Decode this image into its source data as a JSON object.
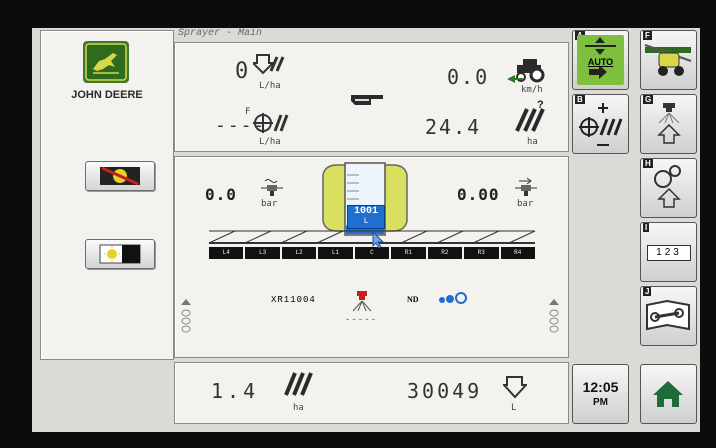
{
  "title": "Sprayer - Main",
  "brand": {
    "name": "JOHN DEERE"
  },
  "rate": {
    "actual_value": "0",
    "actual_unit": "L/ha",
    "target_value": "----",
    "target_super": "F",
    "target_unit": "L/ha"
  },
  "speed": {
    "value": "0.0",
    "unit": "km/h"
  },
  "area_remaining": {
    "value": "24.4",
    "unit": "ha",
    "badge": "?"
  },
  "pressure_left": {
    "value": "0.0",
    "unit": "bar"
  },
  "pressure_right": {
    "value": "0.00",
    "unit": "bar"
  },
  "tank": {
    "value": "1001",
    "unit": "L",
    "fill_fraction": 0.12
  },
  "boom_sections": [
    "L4",
    "L3",
    "L2",
    "L1",
    "C",
    "R1",
    "R2",
    "R3",
    "R4"
  ],
  "nozzle": {
    "name": "XR11004",
    "dashes": "-----",
    "nd_label": "ND"
  },
  "totals": {
    "area_value": "1.4",
    "area_unit": "ha",
    "volume_value": "30049",
    "volume_unit": "L"
  },
  "clock": {
    "time": "12:05",
    "ampm": "PM"
  },
  "softkeys": {
    "a": {
      "letter": "A",
      "label": "AUTO"
    },
    "b": {
      "letter": "B"
    },
    "f": {
      "letter": "F"
    },
    "g": {
      "letter": "G"
    },
    "h": {
      "letter": "H"
    },
    "i": {
      "letter": "I",
      "label": "123"
    },
    "j": {
      "letter": "J"
    }
  },
  "colors": {
    "jd_green": "#3b7a2a",
    "jd_yellow": "#d9d64a",
    "tank_blue": "#1e6fd0",
    "auto_green": "#7fbf3f"
  }
}
